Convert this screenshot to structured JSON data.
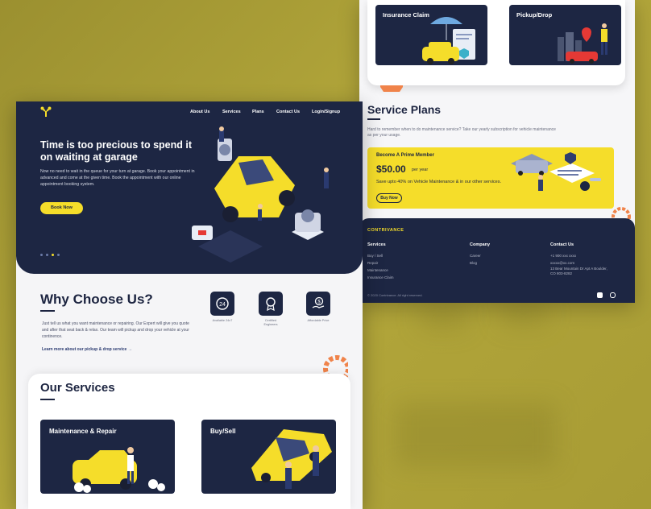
{
  "right_page": {
    "cards": [
      {
        "title": "Insurance Claim",
        "icon": "insurance-illustration"
      },
      {
        "title": "Pickup/Drop",
        "icon": "pickup-illustration"
      }
    ],
    "plans": {
      "title": "Service Plans",
      "description": "Hard to remember when to do maintenance service? Take our yearly subscription for vehicle maintenance as per your usage.",
      "prime": {
        "heading": "Become A Prime Member",
        "price": "$50.00",
        "per": "per year",
        "save": "Save upto 40% on Vehicle Maintenance & in our other services.",
        "button": "Buy Now"
      }
    },
    "footer": {
      "logo": "CONTRIVANCE",
      "columns": [
        {
          "heading": "Services",
          "items": [
            "Buy / Sell",
            "Repair",
            "Maintenance",
            "Insurance Claim"
          ]
        },
        {
          "heading": "Company",
          "items": [
            "Career",
            "Blog"
          ]
        },
        {
          "heading": "Contact Us",
          "items": [
            "+1 900 xxx xxxx",
            "xxxxx@xx.com",
            "13 Bear Mountain Dr Apt A Boulder,",
            "CO 803-8282"
          ]
        }
      ],
      "copyright": "© 2020 Contrivance. All right reserved."
    }
  },
  "left_page": {
    "nav": [
      "About Us",
      "Services",
      "Plans",
      "Contact Us",
      "Login/Signup"
    ],
    "hero": {
      "title": "Time is too precious to spend it on waiting at garage",
      "description": "Now no need to wait in the queue for your turn at garage. Book your appointment in advanced and come at the given time. Book the appointment with our online appointment booking system.",
      "button": "Book Now"
    },
    "why": {
      "title": "Why Choose Us?",
      "text": "Just tell us what you want maintenance or repairing. Our Expert will give you quote and after that seat back & relax. Our team will pickup and drop your vehicle at your continence.",
      "link": "Learn more about our pickup & drop service →",
      "features": [
        {
          "icon": "24-hour-icon",
          "label": "Available 24x7"
        },
        {
          "icon": "badge-icon",
          "label": "Certified Engineers"
        },
        {
          "icon": "money-hand-icon",
          "label": "Affordable Price"
        }
      ]
    },
    "services": {
      "title": "Our Services",
      "cards": [
        {
          "title": "Maintenance & Repair"
        },
        {
          "title": "Buy/Sell"
        }
      ]
    }
  },
  "colors": {
    "navy": "#1d2643",
    "accent": "#f5dd2a",
    "background": "#a59a32"
  }
}
